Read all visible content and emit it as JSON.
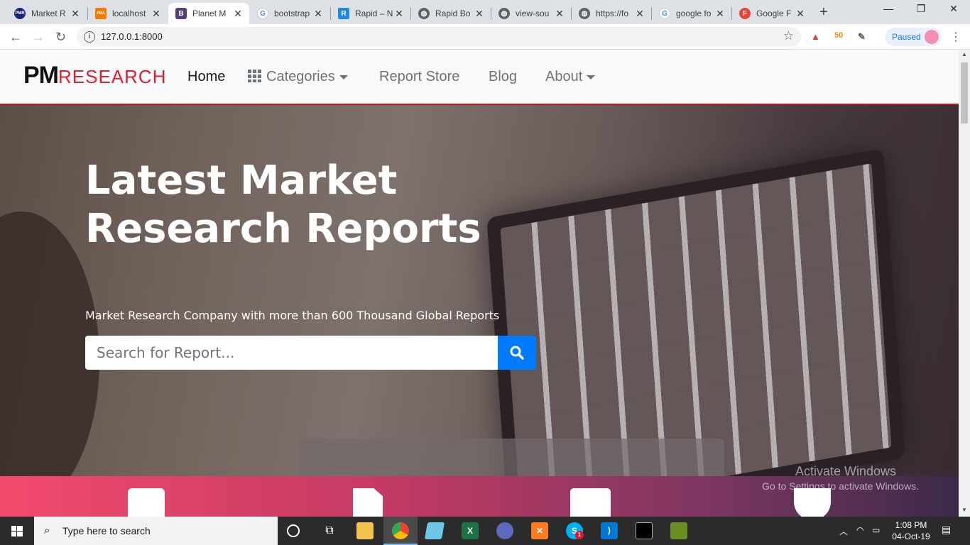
{
  "browser": {
    "tabs": [
      {
        "title": "Market R",
        "favicon": "PMR",
        "color": "#1a237e"
      },
      {
        "title": "localhost",
        "favicon": "PMA",
        "color": "#f57c00"
      },
      {
        "title": "Planet M",
        "favicon": "B",
        "color": "#563d7c"
      },
      {
        "title": "bootstrap",
        "favicon": "G",
        "color": "#4285f4"
      },
      {
        "title": "Rapid – N",
        "favicon": "R",
        "color": "#1e88e5"
      },
      {
        "title": "Rapid Bo",
        "favicon": "globe",
        "color": "#5f6368"
      },
      {
        "title": "view-sou",
        "favicon": "globe",
        "color": "#5f6368"
      },
      {
        "title": "https://fo",
        "favicon": "globe",
        "color": "#5f6368"
      },
      {
        "title": "google fo",
        "favicon": "G",
        "color": "#4285f4"
      },
      {
        "title": "Google F",
        "favicon": "F",
        "color": "#ea4335"
      }
    ],
    "active_tab_index": 2,
    "url": "127.0.0.1:8000",
    "profile_label": "Paused",
    "extension_badge": "50"
  },
  "site": {
    "logo": {
      "pm": "PM",
      "research": "RESEARCH"
    },
    "nav": {
      "home": "Home",
      "categories": "Categories",
      "report_store": "Report Store",
      "blog": "Blog",
      "about": "About"
    },
    "hero": {
      "title": "Latest Market Research Reports",
      "subtitle": "Market Research Company with more than 600 Thousand Global Reports",
      "search_placeholder": "Search for Report..."
    },
    "features": [
      "phone-icon",
      "pdf-icon",
      "mail-icon",
      "shield-icon"
    ],
    "watermark": {
      "title": "Activate Windows",
      "subtitle": "Go to Settings to activate Windows."
    }
  },
  "taskbar": {
    "search_placeholder": "Type here to search",
    "time": "1:08 PM",
    "date": "04-Oct-19",
    "skype_badge": "1"
  }
}
